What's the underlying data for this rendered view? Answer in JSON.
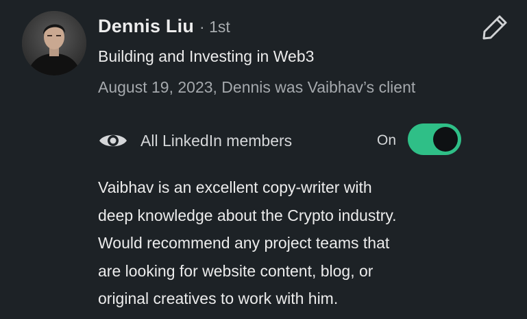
{
  "recommendation": {
    "name": "Dennis Liu",
    "degree": "· 1st",
    "headline": "Building and Investing in Web3",
    "meta": "August 19, 2023, Dennis was Vaibhav’s client",
    "visibility": {
      "label": "All LinkedIn members",
      "status_label": "On",
      "enabled": true
    },
    "text_lines": [
      "Vaibhav is an excellent copy-writer with",
      "deep knowledge about the Crypto industry.",
      "Would recommend any project teams that",
      "are looking for website content, blog, or",
      "original creatives to work with him."
    ],
    "icons": {
      "edit": "pencil-icon",
      "visibility": "eye-icon"
    }
  },
  "colors": {
    "background": "#1d2226",
    "toggle_on": "#2fbf87",
    "secondary_text": "#a5a9ad"
  }
}
